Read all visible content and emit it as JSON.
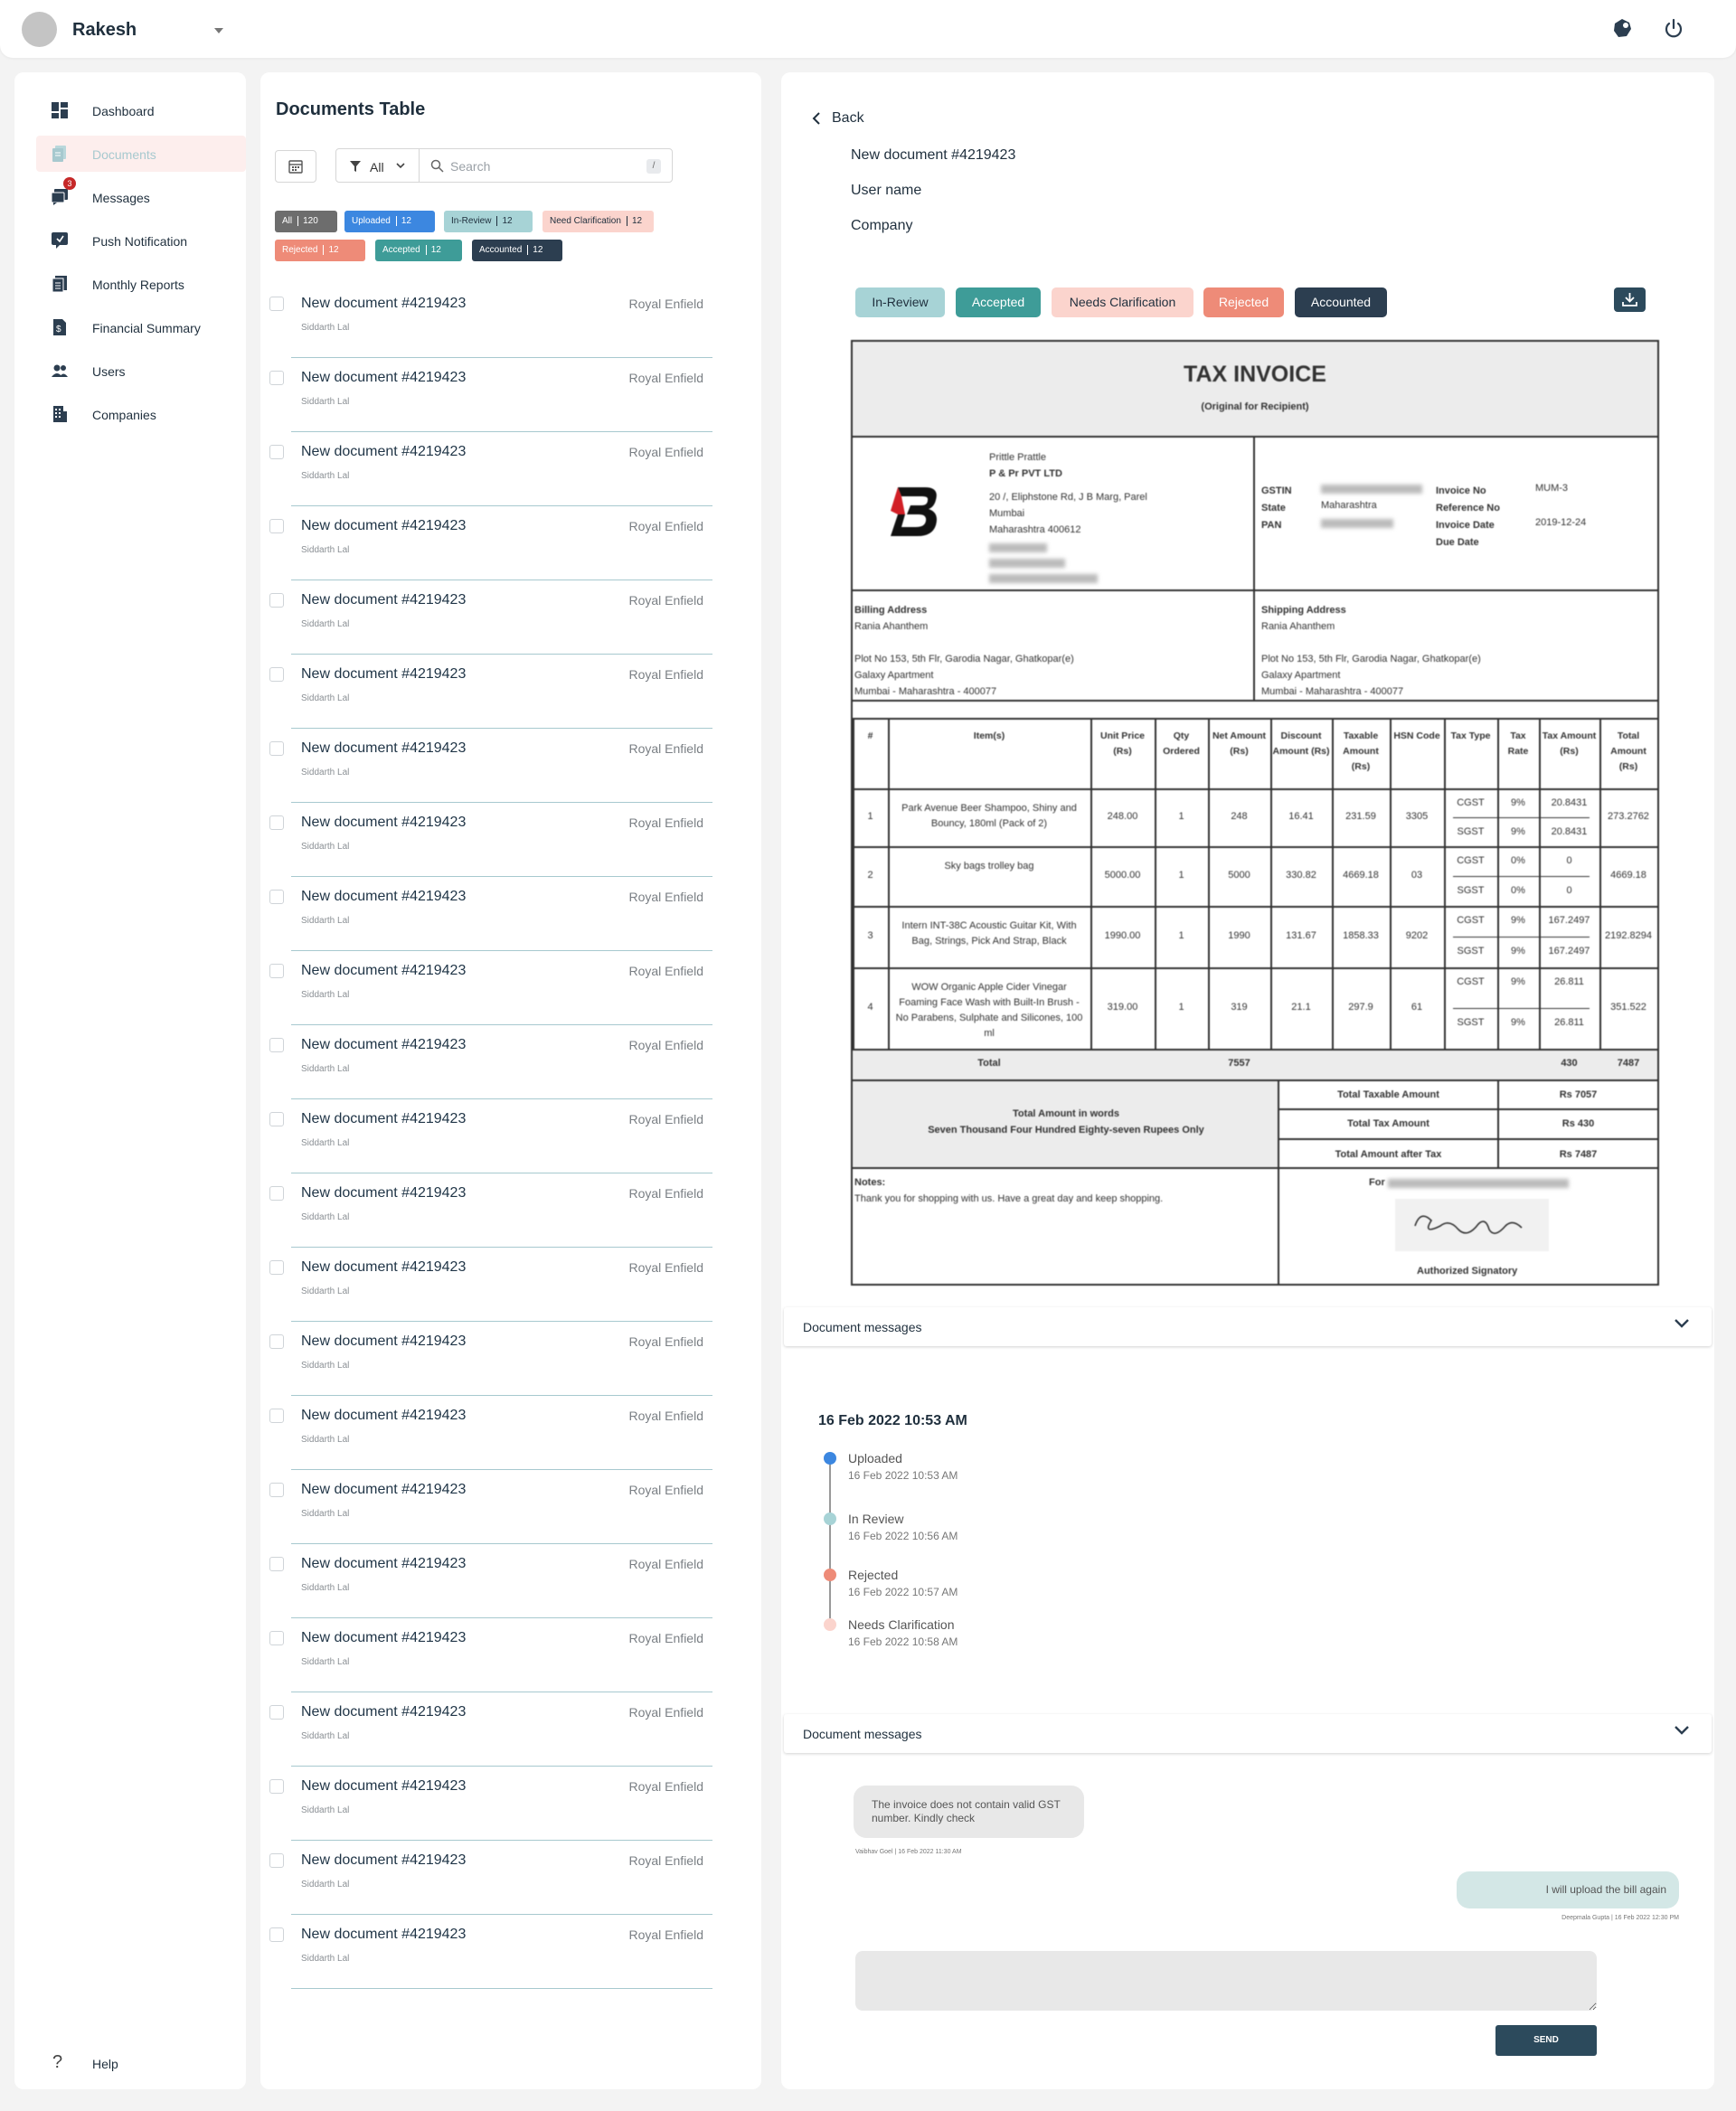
{
  "header": {
    "user_name": "Rakesh"
  },
  "sidebar": {
    "items": [
      {
        "label": "Dashboard",
        "icon": "dashboard-icon"
      },
      {
        "label": "Documents",
        "icon": "documents-icon",
        "active": true
      },
      {
        "label": "Messages",
        "icon": "messages-icon",
        "badge": "3"
      },
      {
        "label": "Push Notification",
        "icon": "notification-icon"
      },
      {
        "label": "Monthly Reports",
        "icon": "reports-icon"
      },
      {
        "label": "Financial Summary",
        "icon": "financial-icon"
      },
      {
        "label": "Users",
        "icon": "users-icon"
      },
      {
        "label": "Companies",
        "icon": "companies-icon"
      }
    ],
    "help_label": "Help"
  },
  "documents": {
    "title": "Documents Table",
    "filter_label": "All",
    "search_placeholder": "Search",
    "search_shortcut": "/",
    "chips": [
      {
        "label": "All",
        "count": "120",
        "bg": "#6d6d6d",
        "fg": "#ffffff"
      },
      {
        "label": "Uploaded",
        "count": "12",
        "bg": "#3c87e0",
        "fg": "#ffffff"
      },
      {
        "label": "In-Review",
        "count": "12",
        "bg": "#a7d3d6",
        "fg": "#1f2f3d"
      },
      {
        "label": "Need Clarification",
        "count": "12",
        "bg": "#fbd4cd",
        "fg": "#1f2f3d"
      },
      {
        "label": "Rejected",
        "count": "12",
        "bg": "#ee8b78",
        "fg": "#ffffff"
      },
      {
        "label": "Accepted",
        "count": "12",
        "bg": "#3e9c98",
        "fg": "#ffffff"
      },
      {
        "label": "Accounted",
        "count": "12",
        "bg": "#2c3e50",
        "fg": "#ffffff"
      }
    ],
    "rows": [
      {
        "title": "New document #4219423",
        "user": "Siddarth Lal",
        "company": "Royal Enfield"
      },
      {
        "title": "New document #4219423",
        "user": "Siddarth Lal",
        "company": "Royal Enfield"
      },
      {
        "title": "New document #4219423",
        "user": "Siddarth Lal",
        "company": "Royal Enfield"
      },
      {
        "title": "New document #4219423",
        "user": "Siddarth Lal",
        "company": "Royal Enfield"
      },
      {
        "title": "New document #4219423",
        "user": "Siddarth Lal",
        "company": "Royal Enfield"
      },
      {
        "title": "New document #4219423",
        "user": "Siddarth Lal",
        "company": "Royal Enfield"
      },
      {
        "title": "New document #4219423",
        "user": "Siddarth Lal",
        "company": "Royal Enfield"
      },
      {
        "title": "New document #4219423",
        "user": "Siddarth Lal",
        "company": "Royal Enfield"
      },
      {
        "title": "New document #4219423",
        "user": "Siddarth Lal",
        "company": "Royal Enfield"
      },
      {
        "title": "New document #4219423",
        "user": "Siddarth Lal",
        "company": "Royal Enfield"
      },
      {
        "title": "New document #4219423",
        "user": "Siddarth Lal",
        "company": "Royal Enfield"
      },
      {
        "title": "New document #4219423",
        "user": "Siddarth Lal",
        "company": "Royal Enfield"
      },
      {
        "title": "New document #4219423",
        "user": "Siddarth Lal",
        "company": "Royal Enfield"
      },
      {
        "title": "New document #4219423",
        "user": "Siddarth Lal",
        "company": "Royal Enfield"
      },
      {
        "title": "New document #4219423",
        "user": "Siddarth Lal",
        "company": "Royal Enfield"
      },
      {
        "title": "New document #4219423",
        "user": "Siddarth Lal",
        "company": "Royal Enfield"
      },
      {
        "title": "New document #4219423",
        "user": "Siddarth Lal",
        "company": "Royal Enfield"
      },
      {
        "title": "New document #4219423",
        "user": "Siddarth Lal",
        "company": "Royal Enfield"
      },
      {
        "title": "New document #4219423",
        "user": "Siddarth Lal",
        "company": "Royal Enfield"
      },
      {
        "title": "New document #4219423",
        "user": "Siddarth Lal",
        "company": "Royal Enfield"
      },
      {
        "title": "New document #4219423",
        "user": "Siddarth Lal",
        "company": "Royal Enfield"
      },
      {
        "title": "New document #4219423",
        "user": "Siddarth Lal",
        "company": "Royal Enfield"
      },
      {
        "title": "New document #4219423",
        "user": "Siddarth Lal",
        "company": "Royal Enfield"
      }
    ]
  },
  "detail": {
    "back_label": "Back",
    "doc_title": "New document #4219423",
    "user_name": "User name",
    "company": "Company",
    "status_buttons": [
      {
        "label": "In-Review",
        "bg": "#a7d3d6",
        "fg": "#1f2f3d"
      },
      {
        "label": "Accepted",
        "bg": "#3e9c98",
        "fg": "#ffffff"
      },
      {
        "label": "Needs Clarification",
        "bg": "#fbd4cd",
        "fg": "#1f2f3d"
      },
      {
        "label": "Rejected",
        "bg": "#ee8b78",
        "fg": "#ffffff"
      },
      {
        "label": "Accounted",
        "bg": "#2c3e50",
        "fg": "#ffffff"
      }
    ],
    "invoice": {
      "title": "TAX INVOICE",
      "subtitle": "(Original for Recipient)",
      "seller": [
        "Prittle Prattle",
        "P & Pr PVT LTD",
        "20 /, Eliphstone Rd, J B Marg, Parel",
        "Mumbai",
        "Maharashtra 400612"
      ],
      "tax_labels": [
        "GSTIN",
        "State",
        "PAN"
      ],
      "state": "Maharashtra",
      "inv_labels": [
        "Invoice No",
        "Reference No",
        "Invoice Date",
        "Due Date"
      ],
      "invoice_no": "MUM-3",
      "invoice_date": "2019-12-24",
      "billing": {
        "heading": "Billing Address",
        "lines": [
          "Rania Ahanthem",
          "",
          "Plot No 153, 5th Flr, Garodia Nagar, Ghatkopar(e)",
          "Galaxy Apartment",
          "Mumbai - Maharashtra - 400077"
        ]
      },
      "shipping": {
        "heading": "Shipping Address",
        "lines": [
          "Rania Ahanthem",
          "",
          "Plot No 153, 5th Flr, Garodia Nagar, Ghatkopar(e)",
          "Galaxy Apartment",
          "Mumbai - Maharashtra - 400077"
        ]
      },
      "columns": [
        "#",
        "Item(s)",
        "Unit Price (Rs)",
        "Qty Ordered",
        "Net Amount (Rs)",
        "Discount Amount (Rs)",
        "Taxable Amount (Rs)",
        "HSN Code",
        "Tax Type",
        "Tax Rate",
        "Tax Amount (Rs)",
        "Total Amount (Rs)"
      ],
      "items": [
        {
          "n": "1",
          "item": "Park Avenue Beer Shampoo, Shiny and Bouncy, 180ml (Pack of 2)",
          "unit": "248.00",
          "qty": "1",
          "net": "248",
          "disc": "16.41",
          "taxable": "231.59",
          "hsn": "3305",
          "t1": "CGST",
          "r1": "9%",
          "a1": "20.8431",
          "t2": "SGST",
          "r2": "9%",
          "a2": "20.8431",
          "total": "273.2762"
        },
        {
          "n": "2",
          "item": "Sky bags trolley bag",
          "unit": "5000.00",
          "qty": "1",
          "net": "5000",
          "disc": "330.82",
          "taxable": "4669.18",
          "hsn": "03",
          "t1": "CGST",
          "r1": "0%",
          "a1": "0",
          "t2": "SGST",
          "r2": "0%",
          "a2": "0",
          "total": "4669.18"
        },
        {
          "n": "3",
          "item": "Intern INT-38C Acoustic Guitar Kit, With Bag, Strings, Pick And Strap, Black",
          "unit": "1990.00",
          "qty": "1",
          "net": "1990",
          "disc": "131.67",
          "taxable": "1858.33",
          "hsn": "9202",
          "t1": "CGST",
          "r1": "9%",
          "a1": "167.2497",
          "t2": "SGST",
          "r2": "9%",
          "a2": "167.2497",
          "total": "2192.8294"
        },
        {
          "n": "4",
          "item": "WOW Organic Apple Cider Vinegar Foaming Face Wash with Built-In Brush - No Parabens, Sulphate and Silicones, 100 ml",
          "unit": "319.00",
          "qty": "1",
          "net": "319",
          "disc": "21.1",
          "taxable": "297.9",
          "hsn": "61",
          "t1": "CGST",
          "r1": "9%",
          "a1": "26.811",
          "t2": "SGST",
          "r2": "9%",
          "a2": "26.811",
          "total": "351.522"
        }
      ],
      "total_label": "Total",
      "total_net": "7557",
      "total_tax": "430",
      "total_amount": "7487",
      "words_label": "Total Amount in words",
      "words": "Seven Thousand Four Hundred Eighty-seven Rupees Only",
      "summary": [
        {
          "label": "Total Taxable Amount",
          "value": "Rs 7057"
        },
        {
          "label": "Total Tax Amount",
          "value": "Rs 430"
        },
        {
          "label": "Total Amount after Tax",
          "value": "Rs 7487"
        }
      ],
      "notes_label": "Notes:",
      "notes": "Thank you for shopping with us. Have a great day and keep shopping.",
      "for_label": "For",
      "signatory": "Authorized Signatory"
    }
  },
  "timeline": {
    "section_label": "Document messages",
    "date": "16 Feb 2022 10:53 AM",
    "events": [
      {
        "title": "Uploaded",
        "time": "16 Feb 2022 10:53 AM",
        "color": "#3c87e0"
      },
      {
        "title": "In Review",
        "time": "16 Feb 2022 10:56 AM",
        "color": "#a7d3d6"
      },
      {
        "title": "Rejected",
        "time": "16 Feb 2022 10:57 AM",
        "color": "#ee8b78"
      },
      {
        "title": "Needs Clarification",
        "time": "16 Feb 2022 10:58 AM",
        "color": "#fbd4cd"
      }
    ]
  },
  "messages": {
    "section_label": "Document messages",
    "items": [
      {
        "text": "The invoice does not contain valid GST number. Kindly check",
        "meta": "Vaibhav Goel | 16 Feb 2022 11:30 AM",
        "side": "left"
      },
      {
        "text": "I will upload the bill again",
        "meta": "Deepmala Gupta | 16 Feb 2022 12:30 PM",
        "side": "right"
      }
    ],
    "input_placeholder": "",
    "send_label": "SEND"
  }
}
